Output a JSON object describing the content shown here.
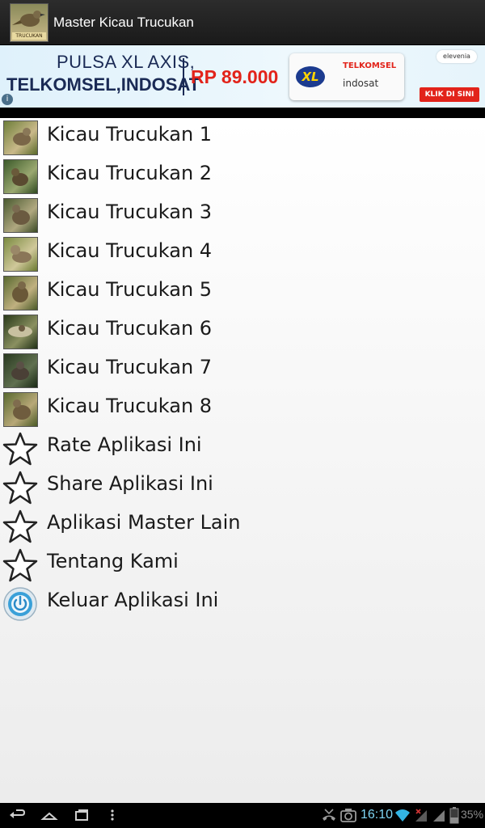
{
  "app": {
    "title": "Master Kicau Trucukan",
    "icon_label": "TRUCUKAN"
  },
  "ad": {
    "line1": "PULSA XL AXIS,",
    "line2": "TELKOMSEL,INDOSAT",
    "price": "RP 89.000",
    "brand1": "TELKOMSEL",
    "brand2": "indosat",
    "xl": "XL",
    "store": "elevenia",
    "cta": "KLIK DI SINI",
    "info": "i"
  },
  "menu": {
    "items": [
      {
        "label": "Kicau Trucukan 1",
        "icon": "bird-thumbnail"
      },
      {
        "label": "Kicau Trucukan 2",
        "icon": "bird-thumbnail"
      },
      {
        "label": "Kicau Trucukan 3",
        "icon": "bird-thumbnail"
      },
      {
        "label": "Kicau Trucukan 4",
        "icon": "bird-thumbnail"
      },
      {
        "label": "Kicau Trucukan 5",
        "icon": "bird-thumbnail"
      },
      {
        "label": "Kicau Trucukan 6",
        "icon": "bird-thumbnail"
      },
      {
        "label": "Kicau Trucukan 7",
        "icon": "bird-thumbnail"
      },
      {
        "label": "Kicau Trucukan 8",
        "icon": "bird-thumbnail"
      },
      {
        "label": "Rate Aplikasi Ini",
        "icon": "star-icon"
      },
      {
        "label": "Share Aplikasi Ini",
        "icon": "star-icon"
      },
      {
        "label": "Aplikasi Master Lain",
        "icon": "star-icon"
      },
      {
        "label": "Tentang Kami",
        "icon": "star-icon"
      },
      {
        "label": "Keluar Aplikasi Ini",
        "icon": "power-icon"
      }
    ]
  },
  "status": {
    "time": "16:10",
    "battery": "35%"
  },
  "colors": {
    "actionbar": "#1f1f1f",
    "text": "#1a1a1a",
    "clock": "#7fd6f5",
    "ad_red": "#e2231a",
    "ad_navy": "#1a2a55"
  }
}
